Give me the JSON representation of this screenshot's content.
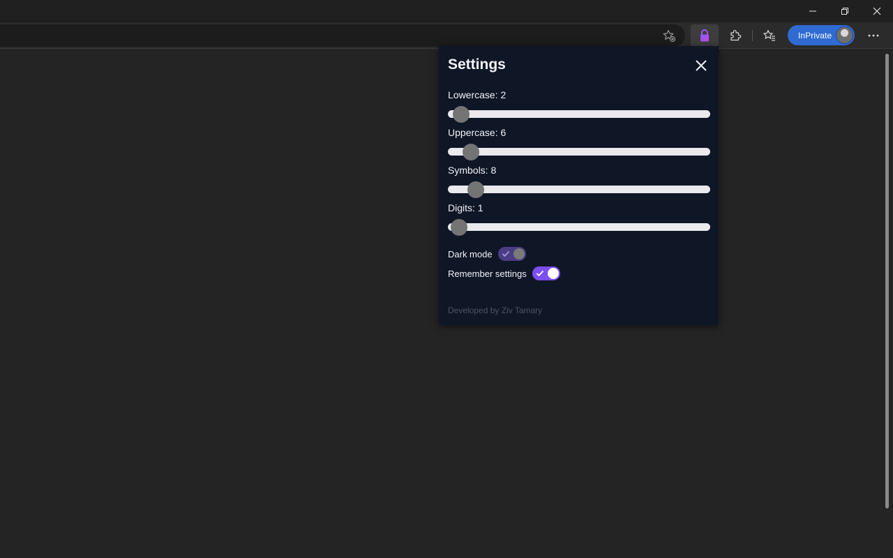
{
  "window": {
    "controls": [
      "minimize",
      "restore",
      "close"
    ]
  },
  "toolbar": {
    "icons": [
      "favorite-add-icon",
      "lock-extension-icon",
      "extensions-icon",
      "favorites-icon",
      "more-icon"
    ],
    "inprivate_label": "InPrivate"
  },
  "popup": {
    "title": "Settings",
    "sliders": [
      {
        "label": "Lowercase: 2",
        "value": 2
      },
      {
        "label": "Uppercase: 6",
        "value": 6
      },
      {
        "label": "Symbols: 8",
        "value": 8
      },
      {
        "label": "Digits: 1",
        "value": 1
      }
    ],
    "toggles": [
      {
        "label": "Dark mode",
        "checked": true
      },
      {
        "label": "Remember settings",
        "checked": true
      }
    ],
    "footer": "Developed by Ziv Tamary",
    "accent_color": "#7b4ff0"
  }
}
